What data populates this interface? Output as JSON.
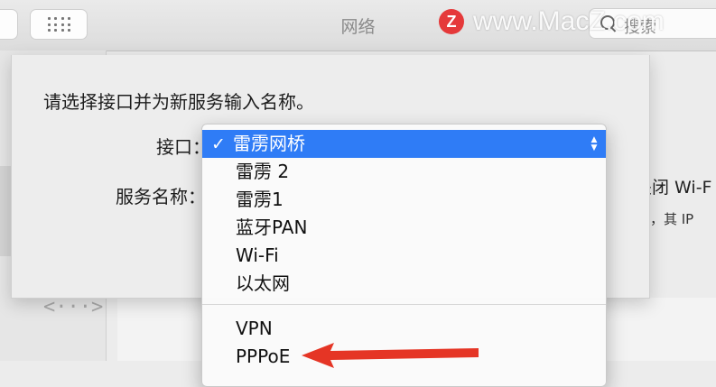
{
  "window": {
    "title": "网络"
  },
  "search": {
    "text": "搜索"
  },
  "watermark": {
    "logo": "Z",
    "text": "www.MacZ.com"
  },
  "sheet": {
    "prompt": "请选择接口并为新服务输入名称。",
    "interface_label": "接口：",
    "service_label": "服务名称："
  },
  "background": {
    "right_text1": "关闭 Wi-F",
    "right_text2": "l”，其 IP"
  },
  "menu": {
    "items": [
      {
        "label": "雷雳网桥",
        "selected": true
      },
      {
        "label": "雷雳 2"
      },
      {
        "label": "雷雳1"
      },
      {
        "label": "蓝牙PAN"
      },
      {
        "label": "Wi-Fi"
      },
      {
        "label": "以太网"
      },
      {
        "label": "VPN"
      },
      {
        "label": "PPPoE"
      }
    ]
  },
  "colors": {
    "accent": "#2f7cf6",
    "annotation_arrow": "#e53525"
  }
}
